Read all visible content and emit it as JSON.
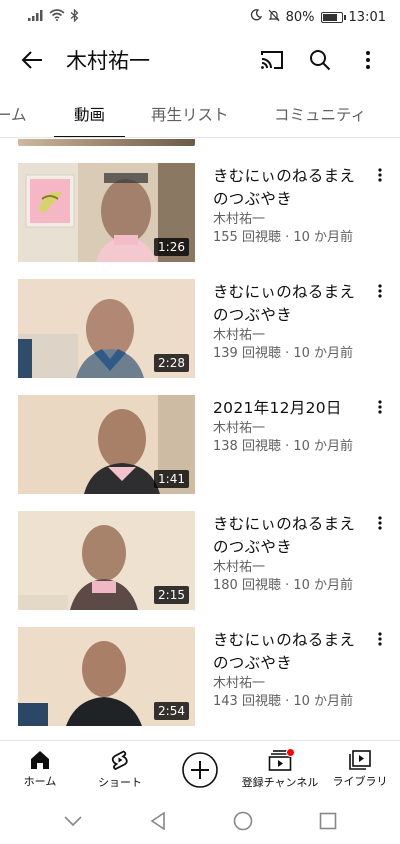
{
  "status_bar": {
    "signal_icon": "signal-icon",
    "wifi_icon": "wifi-icon",
    "bluetooth_icon": "bluetooth-icon",
    "moon_icon": "moon-icon",
    "mute_icon": "bell-off-icon",
    "battery_percent": "80%",
    "battery_level": 0.8,
    "time": "13:01"
  },
  "app_bar": {
    "title": "木村祐一",
    "icons": [
      "back-arrow-icon",
      "cast-icon",
      "search-icon",
      "more-vert-icon"
    ]
  },
  "tabs": [
    {
      "label": "ーム",
      "active": false
    },
    {
      "label": "動画",
      "active": true
    },
    {
      "label": "再生リスト",
      "active": false
    },
    {
      "label": "コミュニティ",
      "active": false
    }
  ],
  "videos": [
    {
      "title": "きむにぃのねるまえのつぶやき",
      "author": "木村祐一",
      "stats": "155 回視聴 · 10 か月前",
      "duration": "1:26"
    },
    {
      "title": "きむにぃのねるまえのつぶやき",
      "author": "木村祐一",
      "stats": "139 回視聴 · 10 か月前",
      "duration": "2:28"
    },
    {
      "title": "2021年12月20日",
      "author": "木村祐一",
      "stats": "138 回視聴 · 10 か月前",
      "duration": "1:41"
    },
    {
      "title": "きむにぃのねるまえのつぶやき",
      "author": "木村祐一",
      "stats": "180 回視聴 · 10 か月前",
      "duration": "2:15"
    },
    {
      "title": "きむにぃのねるまえのつぶやき",
      "author": "木村祐一",
      "stats": "143 回視聴 · 10 か月前",
      "duration": "2:54"
    }
  ],
  "bottom_nav": [
    {
      "label": "ホーム",
      "icon": "home-icon"
    },
    {
      "label": "ショート",
      "icon": "shorts-icon"
    },
    {
      "label": "",
      "icon": "create-plus-icon"
    },
    {
      "label": "登録チャンネル",
      "icon": "subscriptions-icon",
      "badge": true
    },
    {
      "label": "ライブラリ",
      "icon": "library-icon"
    }
  ],
  "system_nav": [
    "chevron-down-icon",
    "back-triangle-icon",
    "home-circle-icon",
    "recents-square-icon"
  ],
  "colors": {
    "accent": "#ff0000",
    "text": "#0f0f0f",
    "secondary": "#606060"
  }
}
